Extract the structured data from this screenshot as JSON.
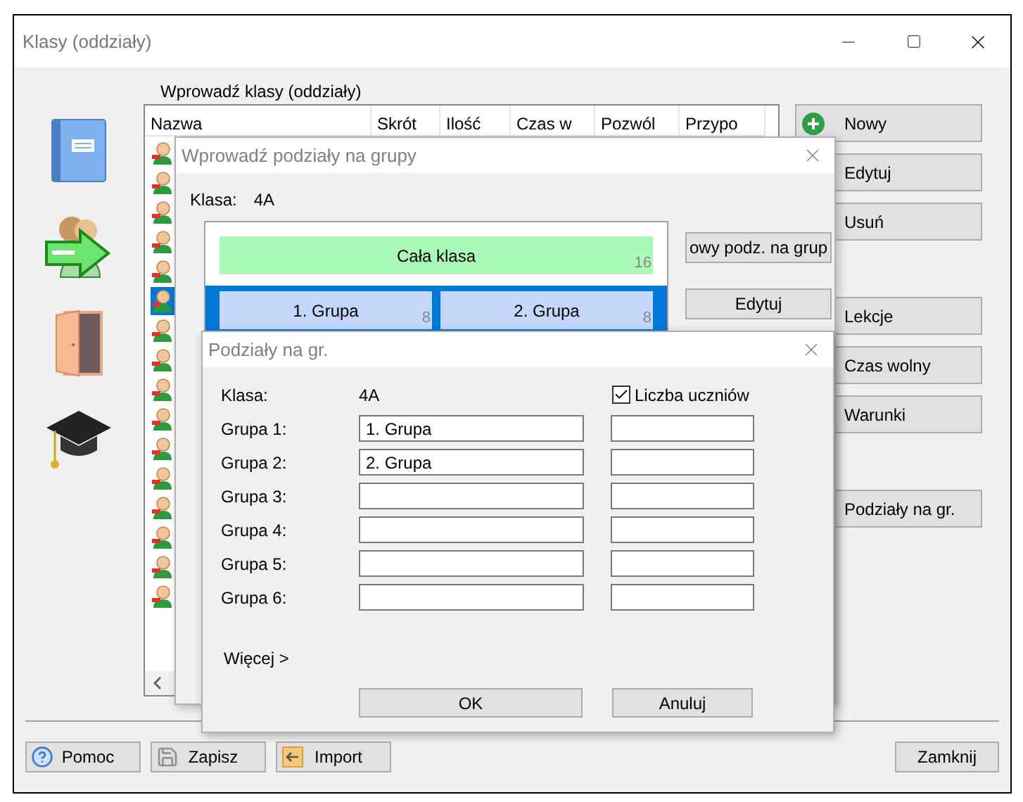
{
  "window": {
    "title": "Klasy (oddziały)"
  },
  "classes_panel": {
    "label": "Wprowadź klasy (oddziały)",
    "columns": [
      "Nazwa",
      "Skrót",
      "Ilość",
      "Czas w",
      "Pozwól",
      "Przypo"
    ],
    "rows": [
      {
        "selected": false
      },
      {
        "selected": false
      },
      {
        "selected": false
      },
      {
        "selected": false
      },
      {
        "selected": false
      },
      {
        "selected": true
      },
      {
        "selected": false
      },
      {
        "selected": false
      },
      {
        "selected": false
      },
      {
        "selected": false
      },
      {
        "selected": false
      },
      {
        "selected": false
      },
      {
        "selected": false
      },
      {
        "selected": false
      },
      {
        "selected": false
      },
      {
        "selected": false
      }
    ]
  },
  "side_button_groups": [
    [
      {
        "label": "Nowy",
        "kind": "add"
      },
      {
        "label": "Edytuj",
        "kind": "plain"
      },
      {
        "label": "Usuń",
        "kind": "plain"
      }
    ],
    [
      {
        "label": "Lekcje",
        "kind": "plain"
      },
      {
        "label": "Czas wolny",
        "kind": "plain"
      },
      {
        "label": "Warunki",
        "kind": "plain"
      }
    ],
    [
      {
        "label": "Podziały na gr.",
        "kind": "plain"
      }
    ]
  ],
  "bottom_buttons": [
    {
      "label": "Pomoc",
      "kind": "help"
    },
    {
      "label": "Zapisz",
      "kind": "save"
    },
    {
      "label": "Import",
      "kind": "import"
    }
  ],
  "close_button": "Zamknij",
  "divisions_dialog": {
    "title": "Wprowadź podziały na grupy",
    "class_label": "Klasa:",
    "class_value": "4A",
    "division_rows": [
      {
        "kind": "whole",
        "selected": false,
        "parts": [
          {
            "label": "Cała klasa",
            "count": "16"
          }
        ]
      },
      {
        "kind": "groups",
        "selected": true,
        "parts": [
          {
            "label": "1. Grupa",
            "count": "8"
          },
          {
            "label": "2. Grupa",
            "count": "8"
          }
        ]
      }
    ],
    "buttons": [
      "owy podz. na grup",
      "Edytuj"
    ]
  },
  "groups_dialog": {
    "title": "Podziały na gr.",
    "class_label": "Klasa:",
    "class_value": "4A",
    "count_toggle": {
      "label": "Liczba uczniów",
      "checked": true
    },
    "rows": [
      {
        "label": "Grupa 1:",
        "value": "1. Grupa"
      },
      {
        "label": "Grupa 2:",
        "value": "2. Grupa"
      },
      {
        "label": "Grupa 3:",
        "value": ""
      },
      {
        "label": "Grupa 4:",
        "value": ""
      },
      {
        "label": "Grupa 5:",
        "value": ""
      },
      {
        "label": "Grupa 6:",
        "value": ""
      }
    ],
    "more_link": "Więcej >",
    "buttons": [
      "OK",
      "Anuluj"
    ]
  }
}
